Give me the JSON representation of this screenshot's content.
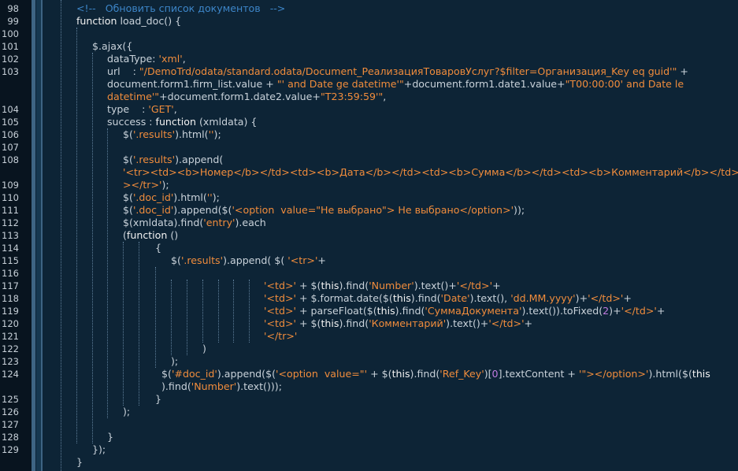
{
  "colors": {
    "background": "#0d2436",
    "gutter": "#08141f",
    "comment": "#3d86c9",
    "string": "#f08c3c",
    "keyword": "#f2f2f2",
    "number": "#c07be0",
    "text": "#c9d2da"
  },
  "line_numbers": [
    "98",
    "99",
    "100",
    "101",
    "102",
    "103",
    "104",
    "105",
    "106",
    "107",
    "108",
    "109",
    "110",
    "111",
    "112",
    "113",
    "114",
    "115",
    "116",
    "117",
    "118",
    "119",
    "120",
    "121",
    "122",
    "123",
    "124",
    "125",
    "126",
    "127",
    "128",
    "129"
  ],
  "lines": [
    [
      [
        "cmt",
        "<!--   Обновить список документов   -->"
      ]
    ],
    [
      [
        "kw",
        "function "
      ],
      [
        "txt",
        "load_doc() {"
      ]
    ],
    [],
    [
      [
        "txt",
        "$.ajax({"
      ]
    ],
    [
      [
        "txt",
        "dataType: "
      ],
      [
        "str",
        "'xml'"
      ],
      [
        "txt",
        ","
      ]
    ],
    [
      [
        "txt",
        "url    : "
      ],
      [
        "str",
        "\"/DemoTrd/odata/standard.odata/Document_РеализацияТоваровУслуг?$filter=Организация_Key eq guid'\""
      ],
      [
        "txt",
        " +"
      ]
    ],
    [
      [
        "txt",
        "document.form1.firm_list.value + "
      ],
      [
        "str",
        "\"' and Date ge datetime'\""
      ],
      [
        "txt",
        "+document.form1.date1.value+"
      ],
      [
        "str",
        "\"T00:00:00' and Date le"
      ]
    ],
    [
      [
        "str",
        "datetime'\""
      ],
      [
        "txt",
        "+document.form1.date2.value+"
      ],
      [
        "str",
        "\"T23:59:59'\""
      ],
      [
        "txt",
        ","
      ]
    ],
    [
      [
        "txt",
        "type    : "
      ],
      [
        "str",
        "'GET'"
      ],
      [
        "txt",
        ","
      ]
    ],
    [
      [
        "txt",
        "success : "
      ],
      [
        "kw",
        "function "
      ],
      [
        "txt",
        "(xmldata) {"
      ]
    ],
    [
      [
        "txt",
        "$("
      ],
      [
        "str",
        "'.results'"
      ],
      [
        "txt",
        ").html("
      ],
      [
        "str",
        "''"
      ],
      [
        "txt",
        ");"
      ]
    ],
    [],
    [
      [
        "txt",
        "$("
      ],
      [
        "str",
        "'.results'"
      ],
      [
        "txt",
        ").append("
      ]
    ],
    [
      [
        "str",
        "'<tr><td><b>Номер</b></td><td><b>Дата</b></td><td><b>Сумма</b></td><td><b>Комментарий</b></td></b"
      ]
    ],
    [
      [
        "str",
        "></tr>'"
      ],
      [
        "txt",
        ");"
      ]
    ],
    [
      [
        "txt",
        "$("
      ],
      [
        "str",
        "'.doc_id'"
      ],
      [
        "txt",
        ").html("
      ],
      [
        "str",
        "''"
      ],
      [
        "txt",
        ");"
      ]
    ],
    [
      [
        "txt",
        "$("
      ],
      [
        "str",
        "'.doc_id'"
      ],
      [
        "txt",
        ").append($("
      ],
      [
        "str",
        "'<option  value=\"Не выбрано\"> Не выбрано</option>'"
      ],
      [
        "txt",
        "));"
      ]
    ],
    [
      [
        "txt",
        "$(xmldata).find("
      ],
      [
        "str",
        "'entry'"
      ],
      [
        "txt",
        ").each"
      ]
    ],
    [
      [
        "txt",
        "("
      ],
      [
        "kw",
        "function "
      ],
      [
        "txt",
        "()"
      ]
    ],
    [
      [
        "txt",
        "{"
      ]
    ],
    [
      [
        "txt",
        "$("
      ],
      [
        "str",
        "'.results'"
      ],
      [
        "txt",
        ").append( $( "
      ],
      [
        "str",
        "'<tr>'"
      ],
      [
        "txt",
        "+"
      ]
    ],
    [],
    [
      [
        "str",
        "'<td>'"
      ],
      [
        "txt",
        " + $("
      ],
      [
        "kw",
        "this"
      ],
      [
        "txt",
        ").find("
      ],
      [
        "str",
        "'Number'"
      ],
      [
        "txt",
        ").text()+"
      ],
      [
        "str",
        "'</td>'"
      ],
      [
        "txt",
        "+"
      ]
    ],
    [
      [
        "str",
        "'<td>'"
      ],
      [
        "txt",
        " + $.format.date($("
      ],
      [
        "kw",
        "this"
      ],
      [
        "txt",
        ").find("
      ],
      [
        "str",
        "'Date'"
      ],
      [
        "txt",
        ").text(), "
      ],
      [
        "str",
        "'dd.MM.yyyy'"
      ],
      [
        "txt",
        ")+"
      ],
      [
        "str",
        "'</td>'"
      ],
      [
        "txt",
        "+"
      ]
    ],
    [
      [
        "str",
        "'<td>'"
      ],
      [
        "txt",
        " + parseFloat($("
      ],
      [
        "kw",
        "this"
      ],
      [
        "txt",
        ").find("
      ],
      [
        "str",
        "'СуммаДокумента'"
      ],
      [
        "txt",
        ").text()).toFixed("
      ],
      [
        "num",
        "2"
      ],
      [
        "txt",
        ")+"
      ],
      [
        "str",
        "'</td>'"
      ],
      [
        "txt",
        "+"
      ]
    ],
    [
      [
        "str",
        "'<td>'"
      ],
      [
        "txt",
        " + $("
      ],
      [
        "kw",
        "this"
      ],
      [
        "txt",
        ").find("
      ],
      [
        "str",
        "'Комментарий'"
      ],
      [
        "txt",
        ").text()+"
      ],
      [
        "str",
        "'</td>'"
      ],
      [
        "txt",
        "+"
      ]
    ],
    [
      [
        "str",
        "'</tr>'"
      ]
    ],
    [
      [
        "txt",
        ")"
      ]
    ],
    [
      [
        "txt",
        ");"
      ]
    ],
    [
      [
        "txt",
        "$("
      ],
      [
        "str",
        "'#doc_id'"
      ],
      [
        "txt",
        ").append($("
      ],
      [
        "str",
        "'<option  value=\"'"
      ],
      [
        "txt",
        " + $("
      ],
      [
        "kw",
        "this"
      ],
      [
        "txt",
        ").find("
      ],
      [
        "str",
        "'Ref_Key'"
      ],
      [
        "txt",
        ")["
      ],
      [
        "num",
        "0"
      ],
      [
        "txt",
        "].textContent + "
      ],
      [
        "str",
        "'\"></option>'"
      ],
      [
        "txt",
        ").html($("
      ],
      [
        "kw",
        "this"
      ]
    ],
    [
      [
        "txt",
        ").find("
      ],
      [
        "str",
        "'Number'"
      ],
      [
        "txt",
        ").text()));"
      ]
    ],
    [
      [
        "txt",
        "}"
      ]
    ],
    [
      [
        "txt",
        ");"
      ]
    ],
    [],
    [
      [
        "txt",
        "}"
      ]
    ],
    [
      [
        "txt",
        "});"
      ]
    ],
    [
      [
        "txt",
        "}"
      ]
    ]
  ]
}
